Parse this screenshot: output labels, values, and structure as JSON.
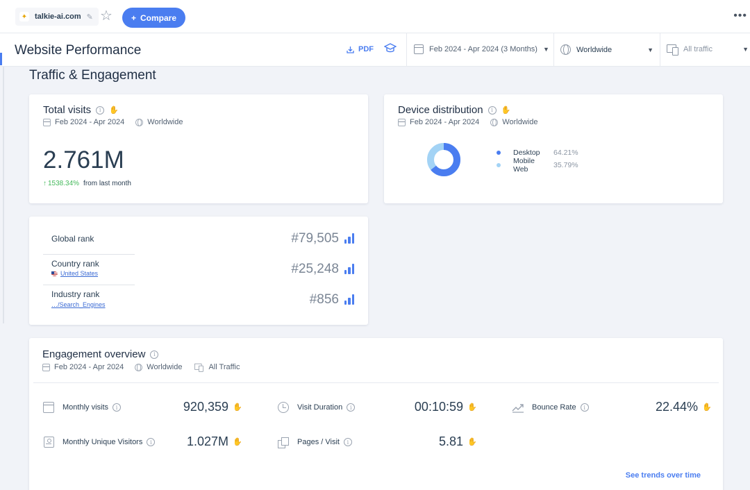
{
  "topbar": {
    "domain": "talkie-ai.com",
    "compare_label": "Compare",
    "more_label": "•••"
  },
  "header": {
    "title": "Website Performance",
    "pdf_label": "PDF",
    "date_range": "Feb 2024 - Apr 2024 (3 Months)",
    "geo": "Worldwide",
    "traffic": "All traffic"
  },
  "section_title": "Traffic & Engagement",
  "total_visits": {
    "title": "Total visits",
    "date": "Feb 2024 - Apr 2024",
    "geo": "Worldwide",
    "value": "2.761M",
    "change": "1538.34%",
    "change_suffix": "from last month"
  },
  "device_distribution": {
    "title": "Device distribution",
    "date": "Feb 2024 - Apr 2024",
    "geo": "Worldwide",
    "items": [
      {
        "name": "Desktop",
        "value": "64.21%",
        "share": 64.21,
        "color": "#4a7df0"
      },
      {
        "name": "Mobile Web",
        "value": "35.79%",
        "share": 35.79,
        "color": "#a3d3f5"
      }
    ]
  },
  "ranks": [
    {
      "label": "Global rank",
      "sub": "",
      "value": "#79,505"
    },
    {
      "label": "Country rank",
      "sub": "United States",
      "value": "#25,248"
    },
    {
      "label": "Industry rank",
      "sub": "…/Search_Engines",
      "value": "#856"
    }
  ],
  "engagement": {
    "title": "Engagement overview",
    "date": "Feb 2024 - Apr 2024",
    "geo": "Worldwide",
    "traffic": "All Traffic",
    "metrics": {
      "monthly_visits": {
        "label": "Monthly visits",
        "value": "920,359"
      },
      "visit_duration": {
        "label": "Visit Duration",
        "value": "00:10:59"
      },
      "bounce_rate": {
        "label": "Bounce Rate",
        "value": "22.44%"
      },
      "unique_visitors": {
        "label": "Monthly Unique Visitors",
        "value": "1.027M"
      },
      "pages_per_visit": {
        "label": "Pages / Visit",
        "value": "5.81"
      }
    },
    "trends_link": "See trends over time"
  },
  "colors": {
    "accent": "#4a7df0",
    "positive": "#44b95b",
    "desktop": "#4a7df0",
    "mobile": "#a3d3f5"
  },
  "icons": [
    "favicon",
    "pencil-icon",
    "star-icon",
    "plus-icon",
    "download-icon",
    "graduation-cap-icon",
    "calendar-icon",
    "globe-icon",
    "devices-icon",
    "info-icon",
    "hand-icon",
    "bar-chart-icon",
    "flag-icon",
    "clock-icon",
    "trend-icon",
    "id-card-icon",
    "pages-icon"
  ]
}
